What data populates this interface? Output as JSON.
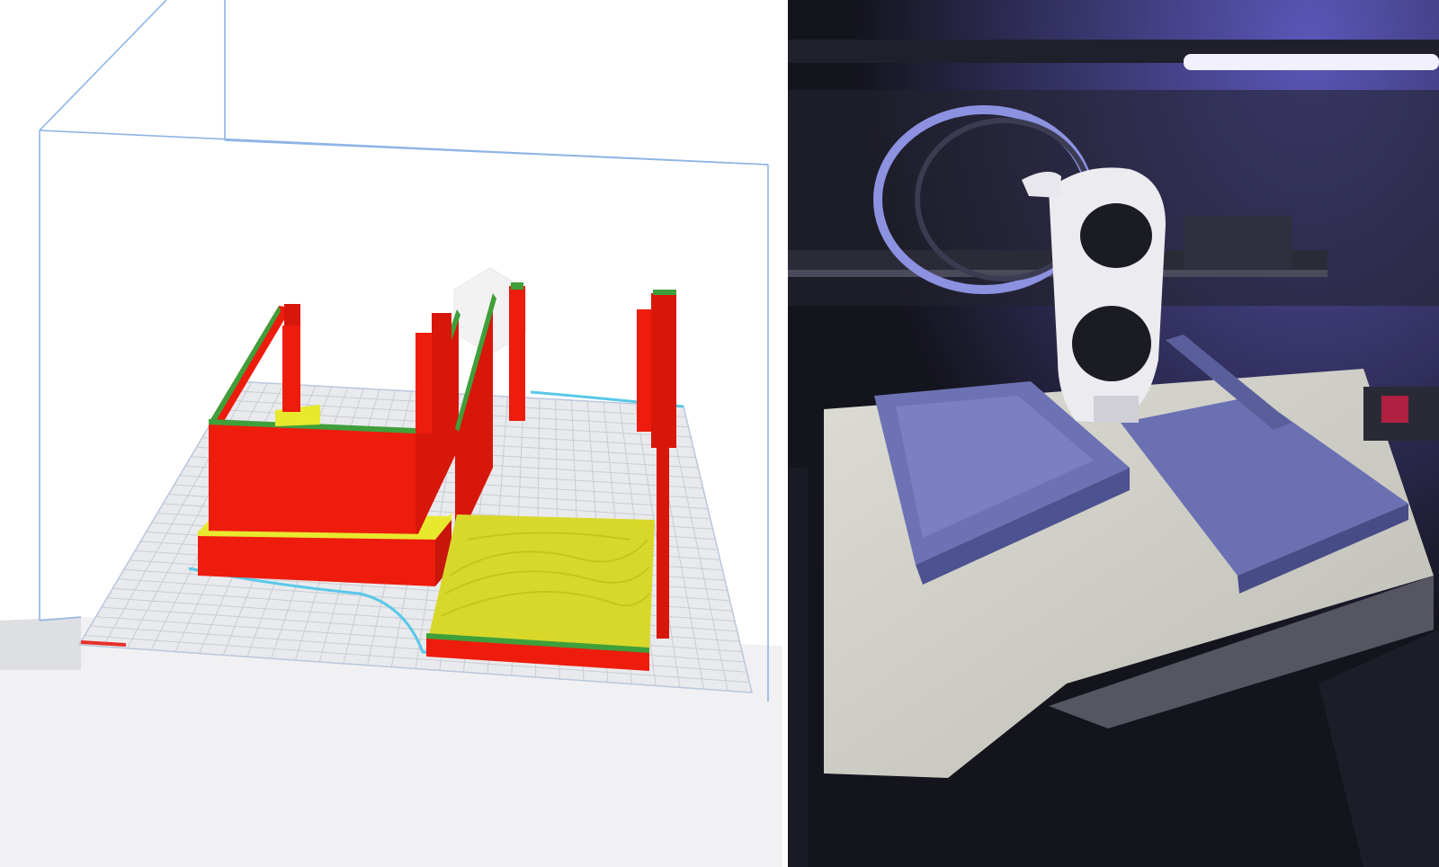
{
  "figure": {
    "panels": [
      {
        "id": "slicer-preview",
        "description_kind": "3D slicer preview of two box parts on a build plate",
        "colors": {
          "background": "#ffffff",
          "build_volume_outline": "#8fb4e6",
          "build_plate": "#e9eaed",
          "grid": "#c9ccd3",
          "walls": "#ee1c0d",
          "wall_edge": "#3f9f3a",
          "top_infill": "#d8d82a",
          "brim_line": "#59c8e8"
        }
      },
      {
        "id": "printer-photo",
        "description_kind": "Photo of a 3D printer enclosure printing the same parts",
        "colors": {
          "background": "#15151f",
          "light_bar": "#f2f0ff",
          "bed": "#cfcfc8",
          "print": "#6a6fb0",
          "toolhead": "#ecebf0"
        }
      }
    ]
  }
}
